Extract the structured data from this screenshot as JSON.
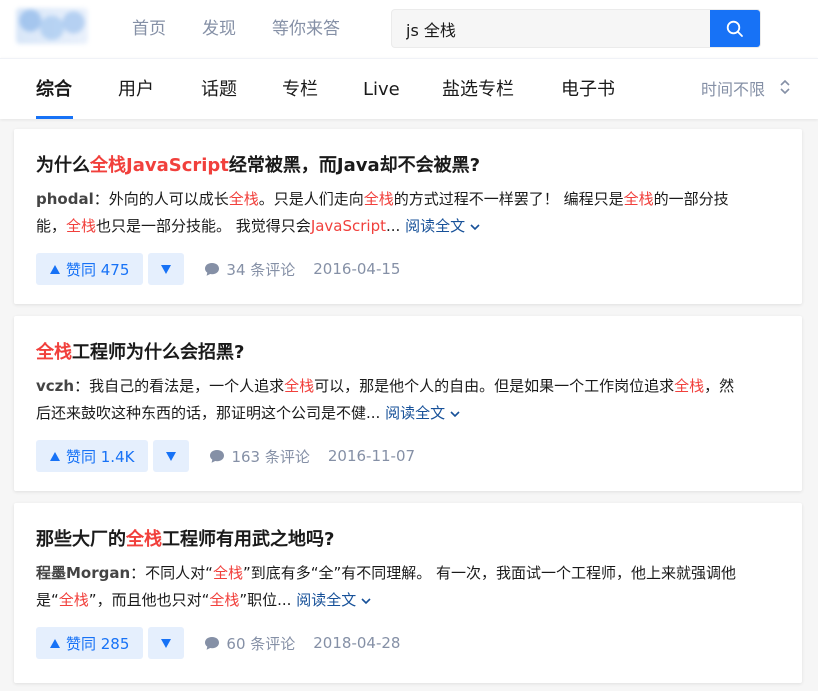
{
  "header": {
    "nav": [
      "首页",
      "发现",
      "等你来答"
    ],
    "search_value": "js 全栈"
  },
  "tabs": {
    "items": [
      "综合",
      "用户",
      "话题",
      "专栏",
      "Live",
      "盐选专栏",
      "电子书"
    ],
    "active": "综合",
    "time_filter": "时间不限"
  },
  "colors": {
    "accent": "#1772f6",
    "highlight": "#f1403c",
    "muted": "#8590a6",
    "readmore": "#175199"
  },
  "results": [
    {
      "title": [
        "为什么",
        "全栈",
        "JavaScript",
        "经常被黑，而Java却不会被黑?"
      ],
      "author": "phodal",
      "excerpt_l1": [
        "：外向的人可以成长",
        "全栈",
        "。只是人们走向",
        "全栈",
        "的方式过程不一样罢了！ 编程只是",
        "全栈",
        "的一部分技"
      ],
      "excerpt_l2": [
        "能，",
        "全栈",
        "也只是一部分技能。 我觉得只会",
        "JavaScript",
        "..."
      ],
      "read_more": "阅读全文",
      "votes": "赞同 475",
      "comments": "34 条评论",
      "date": "2016-04-15"
    },
    {
      "title": [
        "",
        "全栈",
        "工程师为什么会招黑?"
      ],
      "author": "vczh",
      "excerpt_l1": [
        "：我自己的看法是，一个人追求",
        "全栈",
        "可以，那是他个人的自由。但是如果一个工作岗位追求",
        "全栈",
        "，然"
      ],
      "excerpt_l2": [
        "后还来鼓吹这种东西的话，那证明这个公司是不健...",
        "",
        ""
      ],
      "read_more": "阅读全文",
      "votes": "赞同 1.4K",
      "comments": "163 条评论",
      "date": "2016-11-07"
    },
    {
      "title": [
        "那些大厂的",
        "全栈",
        "工程师有用武之地吗?"
      ],
      "author": "程墨Morgan",
      "excerpt_l1": [
        "：不同人对“",
        "全栈",
        "”到底有多“全”有不同理解。 有一次，我面试一个工程师，他上来就强调他"
      ],
      "excerpt_l2": [
        "是“",
        "全栈",
        "”，而且他也只对“",
        "全栈",
        "”职位..."
      ],
      "read_more": "阅读全文",
      "votes": "赞同 285",
      "comments": "60 条评论",
      "date": "2018-04-28"
    }
  ]
}
